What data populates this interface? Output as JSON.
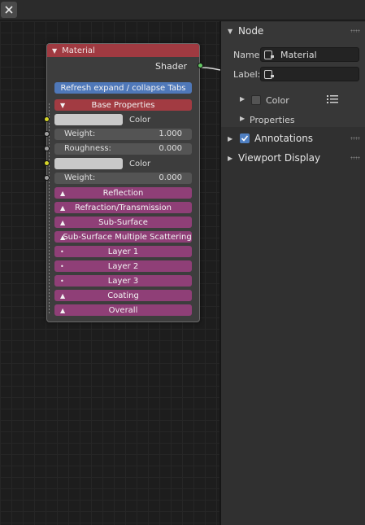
{
  "topbar": {
    "close_label": "close"
  },
  "node": {
    "title": "Material",
    "output_label": "Shader",
    "refresh_label": "Refresh expand / collapse Tabs",
    "base_properties_label": "Base Properties",
    "color1_label": "Color",
    "weight1": {
      "label": "Weight:",
      "value": "1.000"
    },
    "roughness": {
      "label": "Roughness:",
      "value": "0.000"
    },
    "color2_label": "Color",
    "weight2": {
      "label": "Weight:",
      "value": "0.000"
    },
    "tabs": [
      {
        "label": "Reflection",
        "icon": "triangle-up"
      },
      {
        "label": "Refraction/Transmission",
        "icon": "triangle-up"
      },
      {
        "label": "Sub-Surface",
        "icon": "triangle-up"
      },
      {
        "label": "Sub-Surface Multiple Scattering",
        "icon": "triangle-up"
      },
      {
        "label": "Layer 1",
        "icon": "dot"
      },
      {
        "label": "Layer 2",
        "icon": "dot"
      },
      {
        "label": "Layer 3",
        "icon": "dot"
      },
      {
        "label": "Coating",
        "icon": "triangle-up"
      },
      {
        "label": "Overall",
        "icon": "triangle-up"
      }
    ],
    "colors": {
      "header": "#a03a41",
      "refresh": "#4f78b9",
      "base": "#a23b42",
      "tab": "#8f3f77"
    }
  },
  "panel": {
    "node_section": "Node",
    "name_label": "Name:",
    "name_value": "Material",
    "label_label": "Label:",
    "label_value": "",
    "color_label": "Color",
    "properties_label": "Properties",
    "annotations_label": "Annotations",
    "viewport_display_label": "Viewport Display"
  }
}
